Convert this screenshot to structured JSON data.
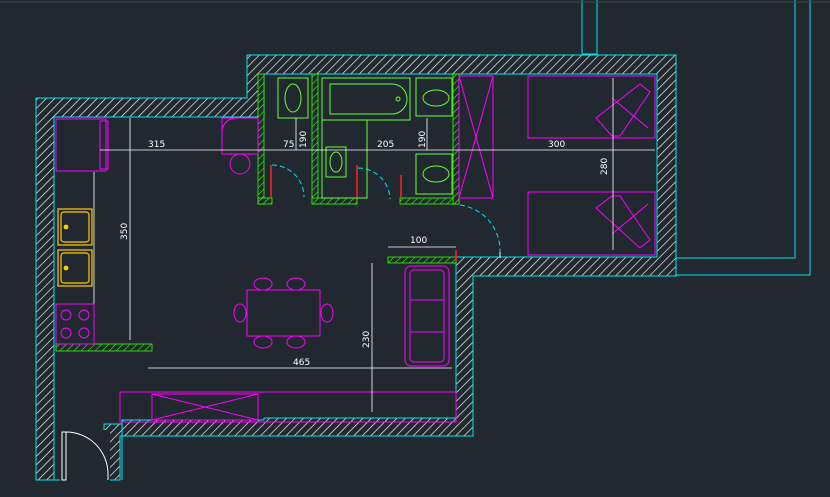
{
  "colors": {
    "background": "#212830",
    "wall_outline": "#00e5ee",
    "hatch": "#ffffff",
    "furniture": "#ff00ff",
    "bathroom_fixture": "#66ff33",
    "kitchen_sink": "#ffcc00",
    "partition_hatch": "#33ff00",
    "dimension": "#ffffff",
    "door_swing": "#00e5ee",
    "red_mark": "#ff2222"
  },
  "dimensions": {
    "kitchen_width": "315",
    "corridor_width": "75",
    "bath_height": "190",
    "bath_width": "205",
    "wc_height": "190",
    "bedroom_width": "300",
    "bedroom_height": "280",
    "kitchen_length": "350",
    "partition_width": "100",
    "living_height": "230",
    "living_width": "465"
  },
  "furniture": {
    "kitchen": [
      "fridge-icon",
      "double-sink-icon",
      "stove-icon"
    ],
    "living": [
      "dining-table-icon",
      "sofa-icon",
      "tv-console-icon",
      "armchair-icon"
    ],
    "bedroom": [
      "bed-icon",
      "bed-icon",
      "wardrobe-icon"
    ],
    "bathroom": [
      "bathtub-icon",
      "washbasin-icon",
      "toilet-icon",
      "shower-icon"
    ]
  }
}
